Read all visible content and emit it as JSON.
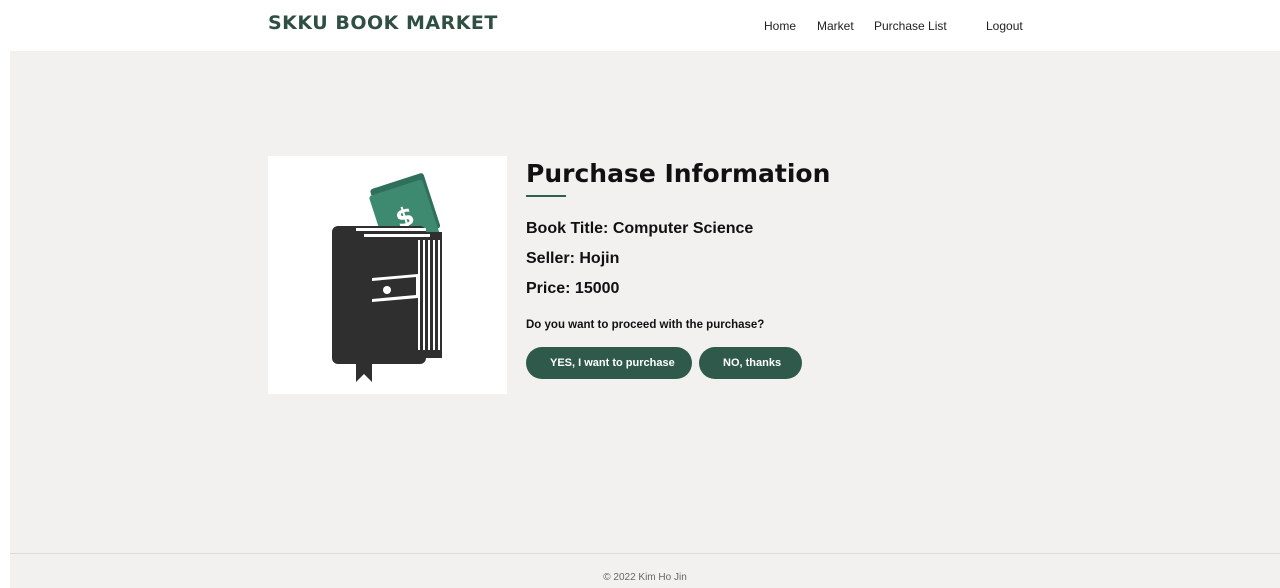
{
  "header": {
    "brand": "SKKU BOOK MARKET",
    "nav": [
      {
        "label": "Home"
      },
      {
        "label": "Market"
      },
      {
        "label": "Purchase List"
      },
      {
        "label": "Logout"
      }
    ]
  },
  "purchase": {
    "title": "Purchase Information",
    "book_title": "Book Title: Computer Science",
    "seller": "Seller: Hojin",
    "price": "Price: 15000",
    "question": "Do you want to proceed with the purchase?",
    "yes_label": "YES, I want to purchase",
    "no_label": "NO, thanks",
    "icon_glyph": "$"
  },
  "footer": {
    "copyright": "© 2022 Kim Ho Jin"
  },
  "colors": {
    "brand": "#2f4f42",
    "button": "#2f5a4b",
    "money": "#3a7a63",
    "background": "#f2f1ef"
  },
  "icons": {
    "product_image": "book-wallet-money-icon"
  }
}
